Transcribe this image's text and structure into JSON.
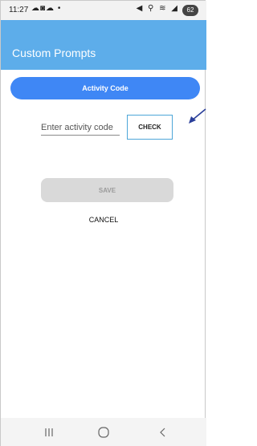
{
  "status_bar": {
    "time": "11:27",
    "left_icons": "☁◙☁ •",
    "right_icons": "◀ ⚲ ≋ ◢",
    "battery": "62"
  },
  "app_bar": {
    "title": "Custom Prompts"
  },
  "tab": {
    "label": "Activity Code"
  },
  "activity_code_input": {
    "value": "",
    "placeholder": "Enter activity code"
  },
  "check_button": {
    "label": "CHECK"
  },
  "save_button": {
    "label": "SAVE",
    "enabled": false
  },
  "cancel": {
    "label": "CANCEL"
  },
  "nav_bar": {
    "icons": [
      "recent-apps-icon",
      "home-icon",
      "back-icon"
    ]
  },
  "colors": {
    "app_bar": "#5dadea",
    "tab_pill": "#3f87f5",
    "check_border": "#4da6d8",
    "save_disabled": "#d9d9d9",
    "annotation_arrow": "#2a3f9a"
  }
}
